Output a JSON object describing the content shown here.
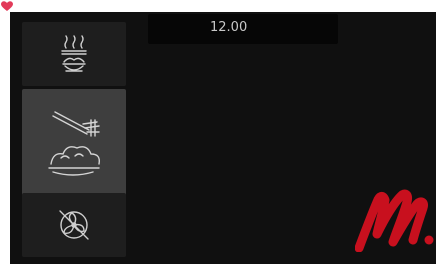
{
  "display": {
    "time": "12.00"
  },
  "modes": [
    {
      "icon": "top-heat-grill-icon",
      "selected": false
    },
    {
      "icon": "program-wand-icon",
      "selected": true
    },
    {
      "icon": "fan-off-icon",
      "selected": false
    }
  ],
  "colors": {
    "screen_bg": "#101010",
    "button_bg": "#1e1e1e",
    "button_selected_bg": "#3e3e3e",
    "icon": "#cfcfcf",
    "watermark": "#c8101e"
  },
  "watermark": {
    "text": "M.C"
  }
}
